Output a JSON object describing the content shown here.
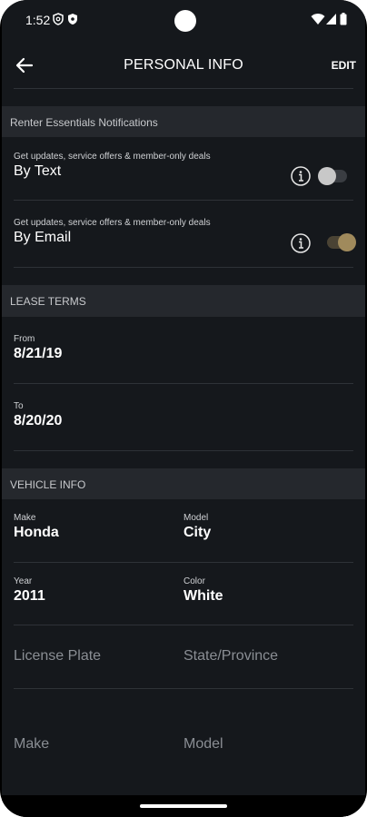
{
  "status_bar": {
    "time": "1:52"
  },
  "app_bar": {
    "title": "PERSONAL INFO",
    "edit_label": "EDIT"
  },
  "notifications": {
    "header": "Renter Essentials Notifications",
    "by_text": {
      "subtitle": "Get updates, service offers & member-only deals",
      "label": "By Text",
      "enabled": false
    },
    "by_email": {
      "subtitle": "Get updates, service offers & member-only deals",
      "label": "By Email",
      "enabled": true
    }
  },
  "lease_terms": {
    "header": "LEASE TERMS",
    "from": {
      "label": "From",
      "value": "8/21/19"
    },
    "to": {
      "label": "To",
      "value": "8/20/20"
    }
  },
  "vehicle_info": {
    "header": "VEHICLE INFO",
    "make": {
      "label": "Make",
      "value": "Honda"
    },
    "model": {
      "label": "Model",
      "value": "City"
    },
    "year": {
      "label": "Year",
      "value": "2011"
    },
    "color": {
      "label": "Color",
      "value": "White"
    },
    "license_plate_placeholder": "License Plate",
    "state_province_placeholder": "State/Province",
    "make_placeholder": "Make",
    "model_placeholder": "Model"
  },
  "colors": {
    "background": "#15181c",
    "section": "#25282d",
    "accent_gold": "#a08a5c"
  }
}
